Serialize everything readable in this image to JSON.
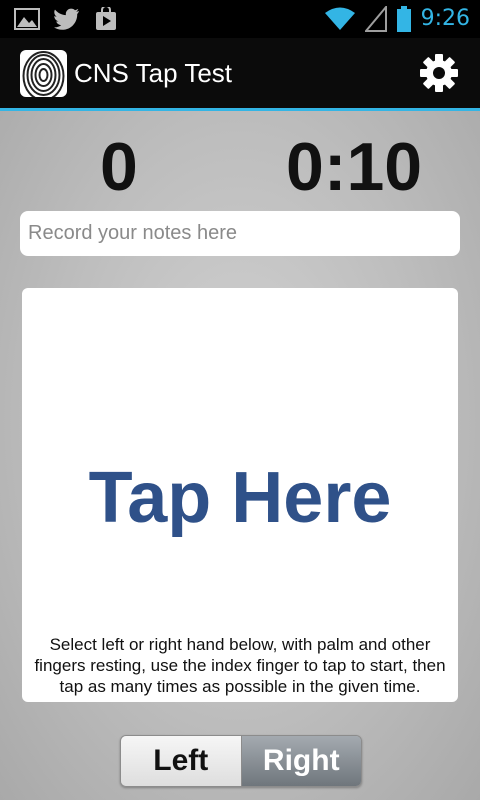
{
  "status_bar": {
    "time": "9:26",
    "icons": [
      "gallery-icon",
      "twitter-icon",
      "play-store-icon",
      "wifi-icon",
      "signal-icon",
      "battery-icon"
    ],
    "accent_color": "#33b5e5"
  },
  "action_bar": {
    "title": "CNS Tap Test",
    "app_icon": "fingerprint-icon",
    "settings_icon": "gear-icon"
  },
  "counters": {
    "tap_count": "0",
    "timer": "0:10"
  },
  "notes": {
    "placeholder": "Record your notes here",
    "value": ""
  },
  "tap_area": {
    "label": "Tap Here",
    "label_color": "#2f5189",
    "instructions": "Select left or right hand below, with palm and other fingers resting, use the index finger to tap to start, then tap as many times as possible in the given time."
  },
  "hand_selector": {
    "options": [
      "Left",
      "Right"
    ],
    "selected": "Right"
  }
}
